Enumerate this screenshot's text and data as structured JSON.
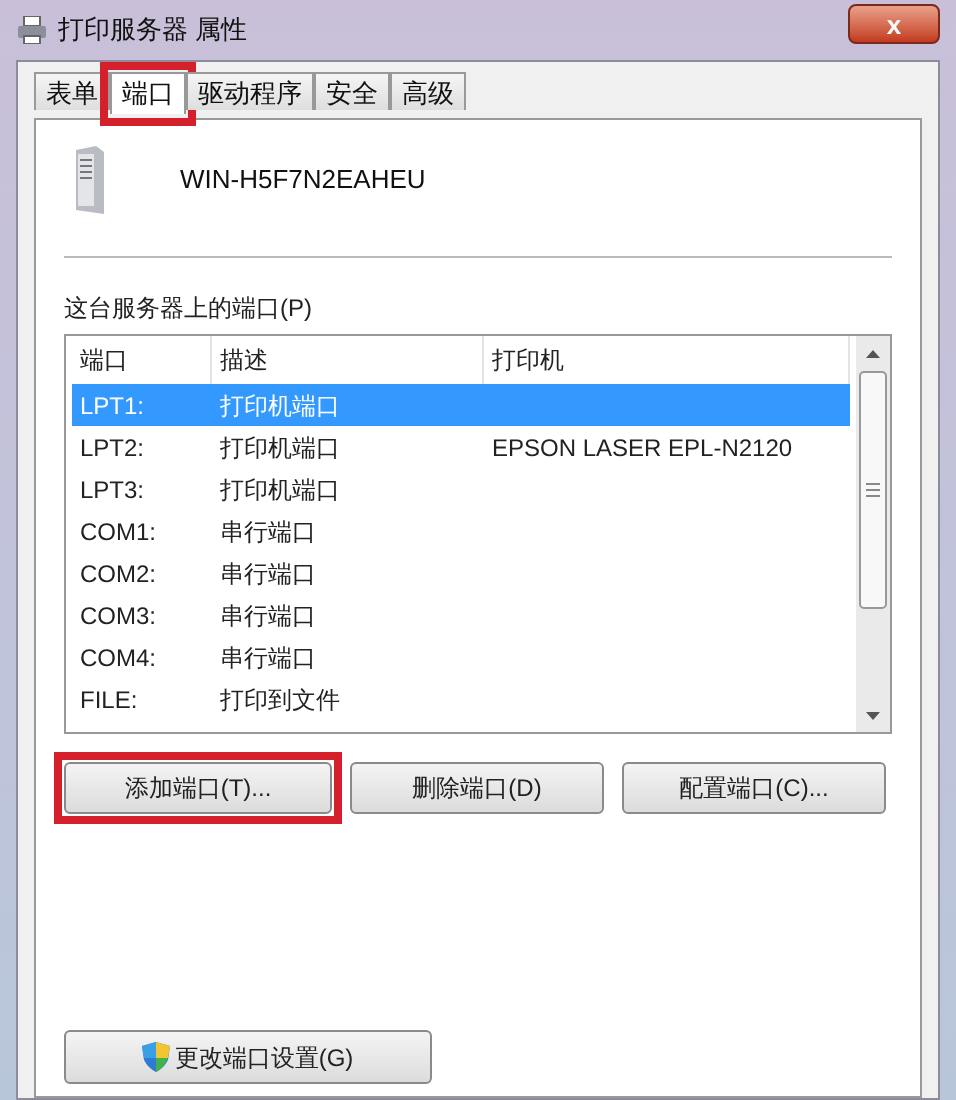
{
  "window": {
    "title": "打印服务器 属性",
    "close": "x"
  },
  "tabs": [
    {
      "label": "表单",
      "selected": false,
      "highlighted": false
    },
    {
      "label": "端口",
      "selected": true,
      "highlighted": true
    },
    {
      "label": "驱动程序",
      "selected": false,
      "highlighted": false
    },
    {
      "label": "安全",
      "selected": false,
      "highlighted": false
    },
    {
      "label": "高级",
      "selected": false,
      "highlighted": false
    }
  ],
  "server_name": "WIN-H5F7N2EAHEU",
  "ports_label": "这台服务器上的端口(P)",
  "table": {
    "columns": [
      "端口",
      "描述",
      "打印机"
    ],
    "rows": [
      {
        "cells": [
          "LPT1:",
          "打印机端口",
          ""
        ],
        "selected": true
      },
      {
        "cells": [
          "LPT2:",
          "打印机端口",
          "EPSON LASER EPL-N2120"
        ],
        "selected": false
      },
      {
        "cells": [
          "LPT3:",
          "打印机端口",
          ""
        ],
        "selected": false
      },
      {
        "cells": [
          "COM1:",
          "串行端口",
          ""
        ],
        "selected": false
      },
      {
        "cells": [
          "COM2:",
          "串行端口",
          ""
        ],
        "selected": false
      },
      {
        "cells": [
          "COM3:",
          "串行端口",
          ""
        ],
        "selected": false
      },
      {
        "cells": [
          "COM4:",
          "串行端口",
          ""
        ],
        "selected": false
      },
      {
        "cells": [
          "FILE:",
          "打印到文件",
          ""
        ],
        "selected": false
      }
    ]
  },
  "buttons": [
    {
      "label": "添加端口(T)...",
      "highlighted": true
    },
    {
      "label": "删除端口(D)",
      "highlighted": false
    },
    {
      "label": "配置端口(C)...",
      "highlighted": false
    }
  ],
  "settings_button": {
    "label": "更改端口设置(G)"
  }
}
